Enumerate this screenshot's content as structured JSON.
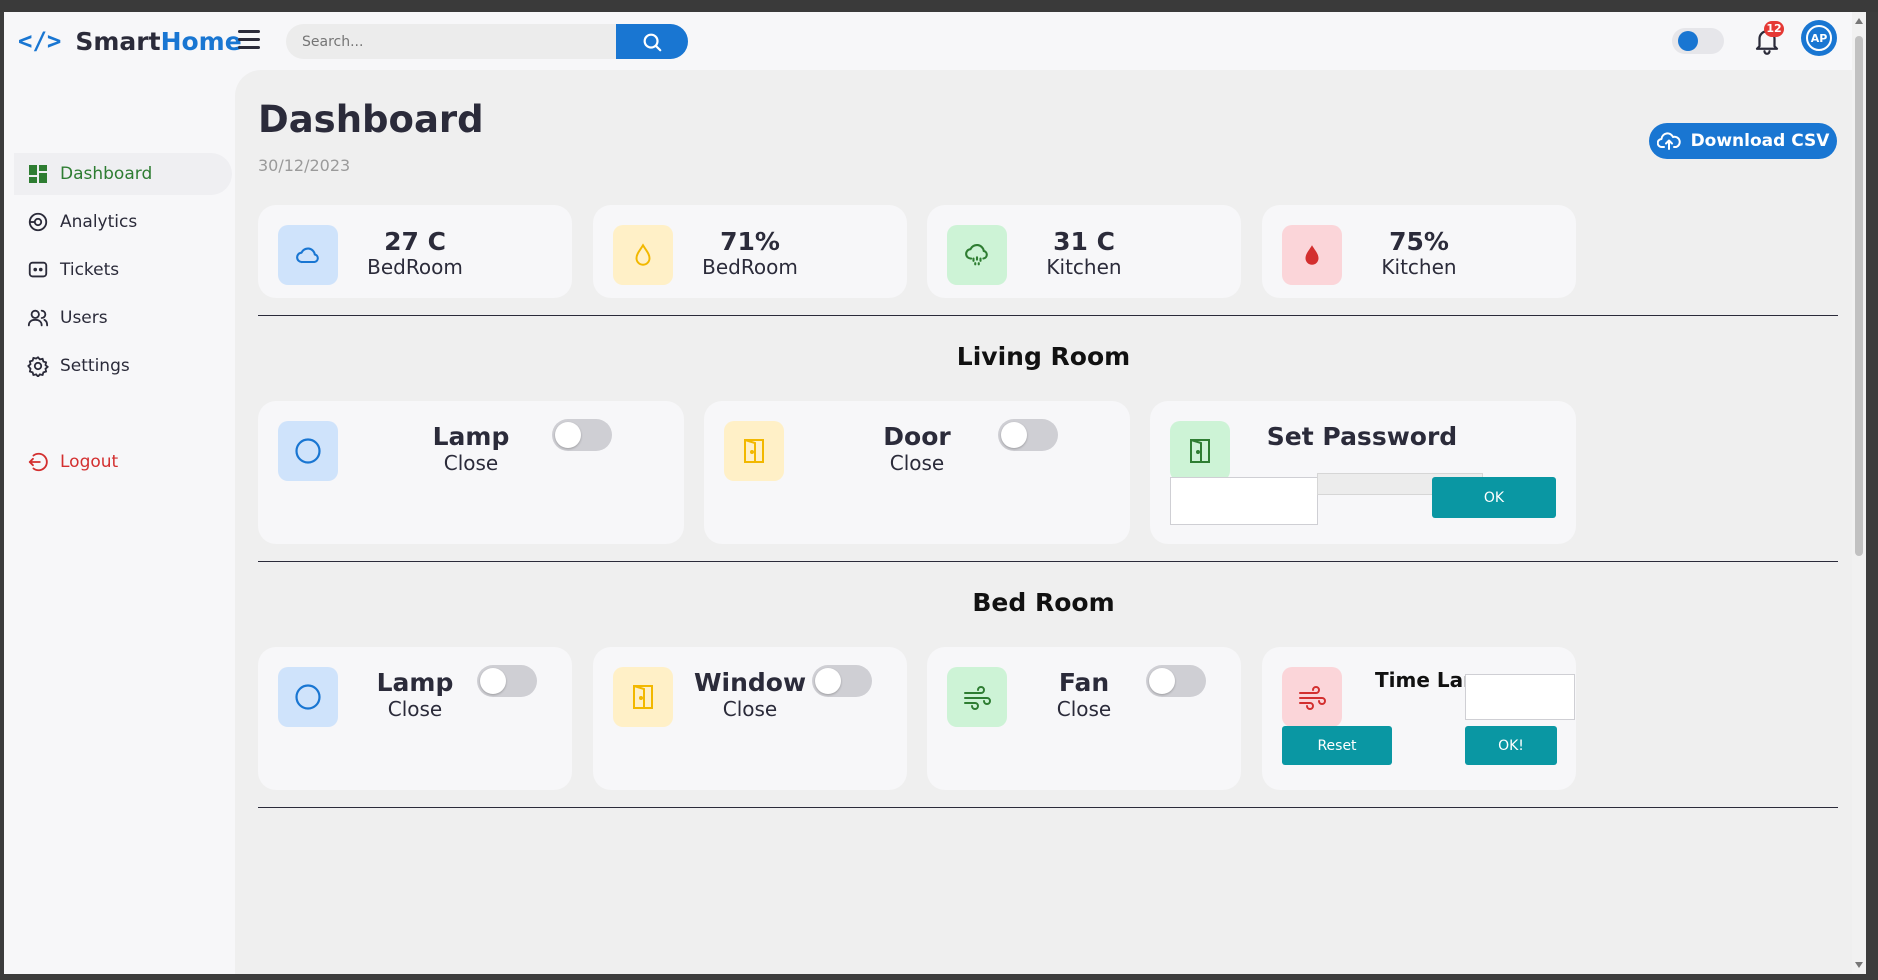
{
  "app": {
    "brand_smart": "Smart",
    "brand_home": "Home",
    "brand_icon": "code-icon"
  },
  "header": {
    "search_placeholder": "Search...",
    "notification_count": "12",
    "avatar_initials": "AP"
  },
  "sidebar": {
    "items": [
      {
        "label": "Dashboard",
        "icon": "dashboard-icon",
        "active": true
      },
      {
        "label": "Analytics",
        "icon": "analytics-icon"
      },
      {
        "label": "Tickets",
        "icon": "tickets-icon"
      },
      {
        "label": "Users",
        "icon": "users-icon"
      },
      {
        "label": "Settings",
        "icon": "settings-icon"
      }
    ],
    "logout": "Logout"
  },
  "main": {
    "title": "Dashboard",
    "date": "30/12/2023",
    "download_label": "Download CSV",
    "stats": [
      {
        "value": "27 C",
        "label": "BedRoom",
        "icon": "cloud-icon",
        "color": "#1976d2"
      },
      {
        "value": "71%",
        "label": "BedRoom",
        "icon": "droplet-icon",
        "color": "#f2b800"
      },
      {
        "value": "31 C",
        "label": "Kitchen",
        "icon": "cloud-drizzle-icon",
        "color": "#2e7d32"
      },
      {
        "value": "75%",
        "label": "Kitchen",
        "icon": "drop-filled-icon",
        "color": "#d32f2f"
      }
    ],
    "living_room": {
      "title": "Living Room",
      "lamp": {
        "name": "Lamp",
        "state": "Close"
      },
      "door": {
        "name": "Door",
        "state": "Close"
      },
      "password": {
        "title": "Set Password",
        "ok_label": "OK"
      }
    },
    "bed_room": {
      "title": "Bed Room",
      "lamp": {
        "name": "Lamp",
        "state": "Close"
      },
      "window": {
        "name": "Window",
        "state": "Close"
      },
      "fan": {
        "name": "Fan",
        "state": "Close"
      },
      "time_lamp": {
        "title": "Time Lamp",
        "reset_label": "Reset",
        "ok_label": "OK!"
      }
    }
  },
  "colors": {
    "accent": "#1976d2",
    "active_nav": "#2e7d32",
    "logout": "#d32f2f",
    "teal_button": "#0a97a3"
  }
}
